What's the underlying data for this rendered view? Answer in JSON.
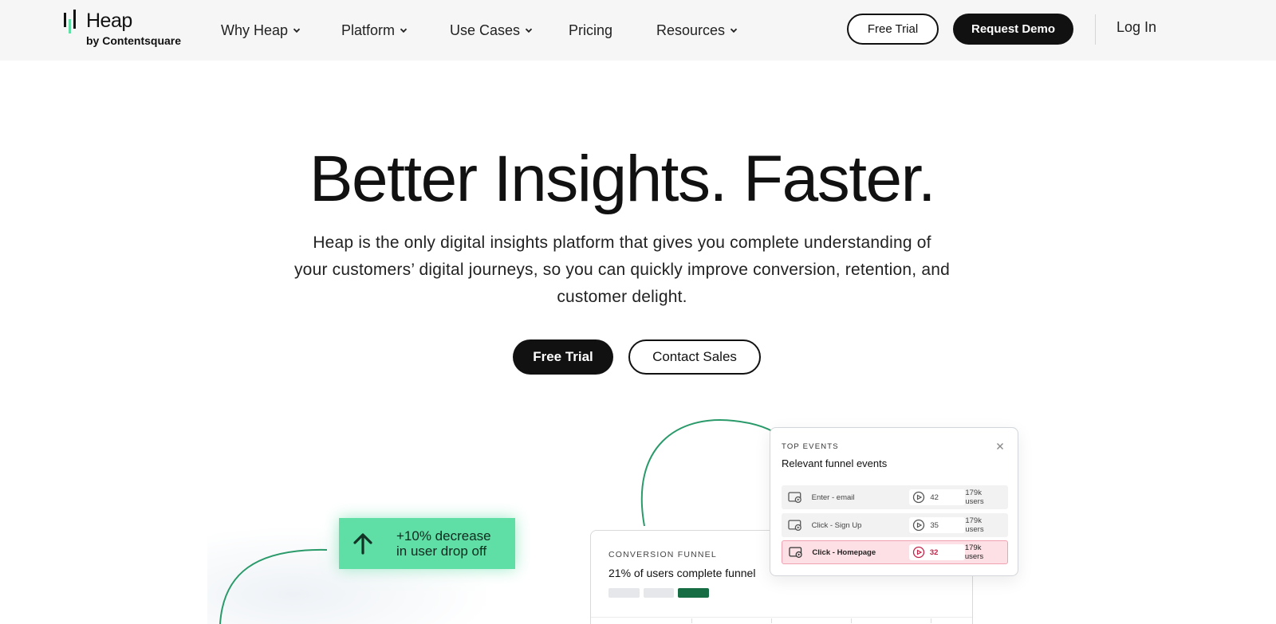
{
  "header": {
    "logo": {
      "wordmark": "Heap",
      "byline": "by Contentsquare"
    },
    "nav": [
      {
        "label": "Why Heap",
        "has_dropdown": true
      },
      {
        "label": "Platform",
        "has_dropdown": true
      },
      {
        "label": "Use Cases",
        "has_dropdown": true
      },
      {
        "label": "Pricing",
        "has_dropdown": false
      },
      {
        "label": "Resources",
        "has_dropdown": true
      }
    ],
    "free_trial": "Free Trial",
    "request_demo": "Request Demo",
    "login": "Log In"
  },
  "hero": {
    "title": "Better Insights. Faster.",
    "subtitle_lines": [
      "Heap is the only digital insights platform that gives you complete understanding of",
      "your customers’ digital journeys, so you can quickly improve conversion, retention, and",
      "customer delight."
    ],
    "cta_primary": "Free Trial",
    "cta_secondary": "Contact Sales"
  },
  "illustration": {
    "badge": {
      "line1": "+10% decrease",
      "line2": "in user drop off",
      "icon": "arrow-up-icon"
    },
    "funnel": {
      "label": "CONVERSION FUNNEL",
      "title": "21% of users complete funnel"
    },
    "events": {
      "label": "TOP EVENTS",
      "title": "Relevant funnel events",
      "rows": [
        {
          "name": "Enter - email",
          "sessions": "42",
          "users": "179k users",
          "highlighted": false
        },
        {
          "name": "Click - Sign Up",
          "sessions": "35",
          "users": "179k users",
          "highlighted": false
        },
        {
          "name": "Click - Homepage",
          "sessions": "32",
          "users": "179k users",
          "highlighted": true
        }
      ]
    }
  },
  "colors": {
    "accent_green": "#5fdea5",
    "dark_green": "#166d43",
    "curve_green": "#2a9a6a",
    "dark": "#111111",
    "header_bg": "#f6f6f6",
    "highlight_pink": "#fde0e5"
  }
}
